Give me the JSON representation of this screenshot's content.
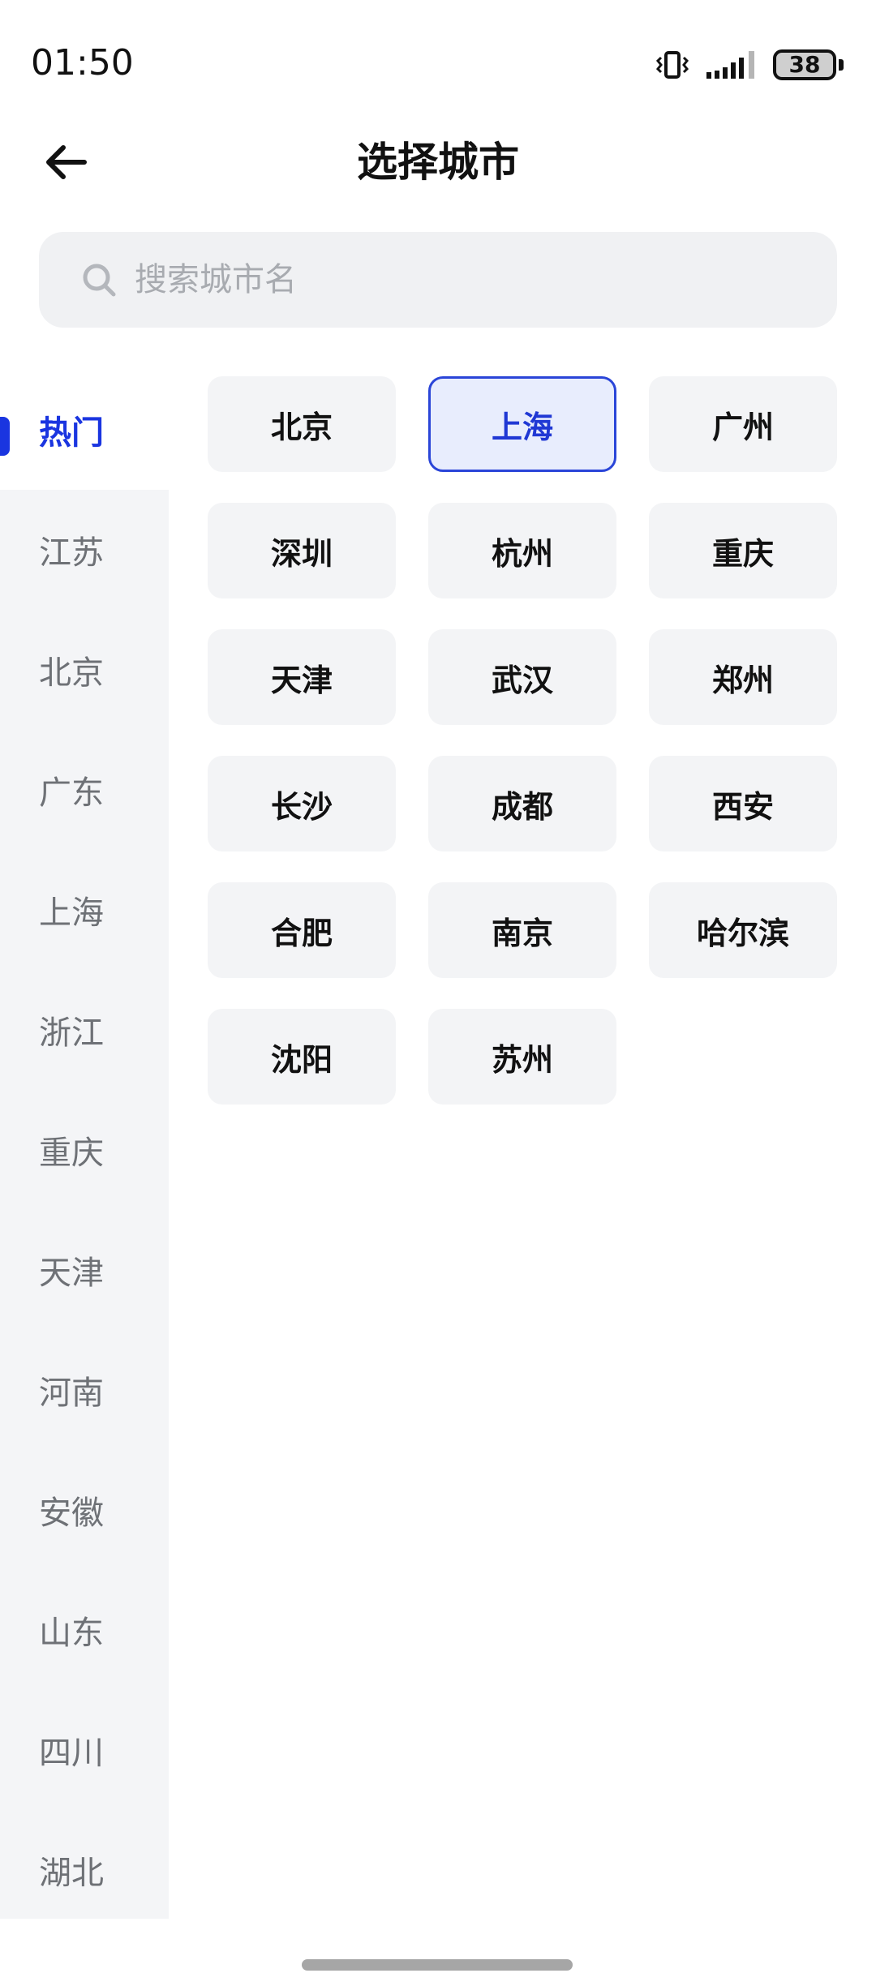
{
  "status_bar": {
    "time": "01:50",
    "battery": "38",
    "icons": [
      "vibrate-icon",
      "signal-icon",
      "battery-icon"
    ]
  },
  "header": {
    "title": "选择城市",
    "back_icon": "arrow-left-icon"
  },
  "search": {
    "placeholder": "搜索城市名",
    "icon": "search-icon"
  },
  "sidebar": {
    "items": [
      {
        "label": "热门",
        "active": true
      },
      {
        "label": "江苏"
      },
      {
        "label": "北京"
      },
      {
        "label": "广东"
      },
      {
        "label": "上海"
      },
      {
        "label": "浙江"
      },
      {
        "label": "重庆"
      },
      {
        "label": "天津"
      },
      {
        "label": "河南"
      },
      {
        "label": "安徽"
      },
      {
        "label": "山东"
      },
      {
        "label": "四川"
      },
      {
        "label": "湖北"
      }
    ]
  },
  "cities": [
    {
      "name": "北京"
    },
    {
      "name": "上海",
      "selected": true
    },
    {
      "name": "广州"
    },
    {
      "name": "深圳"
    },
    {
      "name": "杭州"
    },
    {
      "name": "重庆"
    },
    {
      "name": "天津"
    },
    {
      "name": "武汉"
    },
    {
      "name": "郑州"
    },
    {
      "name": "长沙"
    },
    {
      "name": "成都"
    },
    {
      "name": "西安"
    },
    {
      "name": "合肥"
    },
    {
      "name": "南京"
    },
    {
      "name": "哈尔滨"
    },
    {
      "name": "沈阳"
    },
    {
      "name": "苏州"
    }
  ],
  "colors": {
    "accent": "#1a35e0",
    "selected_bg": "#e8edfd",
    "cell_bg": "#f3f4f6",
    "sidebar_bg": "#f4f5f7"
  }
}
